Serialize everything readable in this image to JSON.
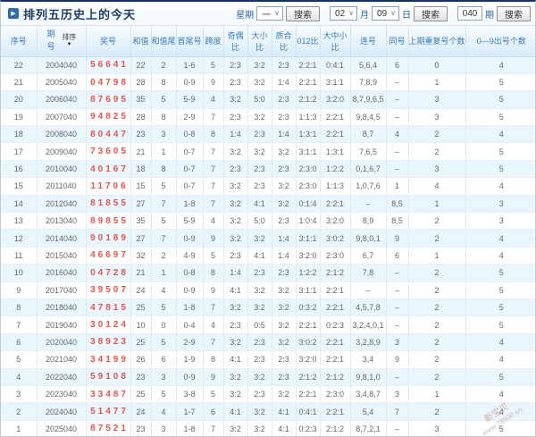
{
  "header": {
    "title": "排列五历史上的今天"
  },
  "controls": {
    "week_label": "星期",
    "week_value": "一",
    "month_value": "02",
    "month_label": "月",
    "day_value": "09",
    "day_label": "日",
    "issue_value": "040",
    "issue_label": "期",
    "search_label": "搜索"
  },
  "table": {
    "sort_label": "排序",
    "columns": [
      "序号",
      "期号",
      "奖号",
      "和值",
      "和值尾",
      "首尾号",
      "跨度",
      "奇偶比",
      "大小比",
      "质合比",
      "012比",
      "大中小比",
      "连号",
      "同号",
      "上期重复号个数",
      "0—9出号个数"
    ],
    "rows": [
      [
        "22",
        "2004040",
        "56641",
        "22",
        "2",
        "1-6",
        "5",
        "2:3",
        "3:2",
        "2:3",
        "2:2:1",
        "0:4:1",
        "5,6,4",
        "6",
        "0",
        "4"
      ],
      [
        "21",
        "2005040",
        "04798",
        "28",
        "8",
        "0-9",
        "9",
        "2:3",
        "3:2",
        "1:4",
        "2:2:1",
        "3:1:1",
        "7,8,9",
        "–",
        "1",
        "5"
      ],
      [
        "20",
        "2006040",
        "87695",
        "35",
        "5",
        "5-9",
        "4",
        "3:2",
        "5:0",
        "2:3",
        "2:1:2",
        "3:2:0",
        "8,7,9,6,5",
        "–",
        "3",
        "5"
      ],
      [
        "19",
        "2007040",
        "94825",
        "28",
        "8",
        "2-9",
        "7",
        "2:3",
        "3:2",
        "2:3",
        "1:1:3",
        "2:2:1",
        "9,8,4,5",
        "–",
        "3",
        "5"
      ],
      [
        "18",
        "2008040",
        "80447",
        "23",
        "3",
        "0-8",
        "8",
        "1:4",
        "2:3",
        "1:4",
        "1:3:1",
        "2:2:1",
        "8,7",
        "4",
        "2",
        "4"
      ],
      [
        "17",
        "2009040",
        "73605",
        "21",
        "1",
        "0-7",
        "7",
        "3:2",
        "3:2",
        "3:2",
        "3:1:1",
        "1:3:1",
        "7,6,5",
        "–",
        "2",
        "5"
      ],
      [
        "16",
        "2010040",
        "40167",
        "18",
        "8",
        "0-7",
        "7",
        "2:3",
        "2:3",
        "2:3",
        "2:3:0",
        "1:2:2",
        "0,1,6,7",
        "–",
        "3",
        "5"
      ],
      [
        "15",
        "2011040",
        "11706",
        "15",
        "5",
        "0-7",
        "7",
        "3:2",
        "2:3",
        "3:2",
        "2:3:0",
        "1:1:3",
        "1,0,7,6",
        "1",
        "4",
        "4"
      ],
      [
        "14",
        "2012040",
        "81855",
        "27",
        "7",
        "1-8",
        "7",
        "3:2",
        "4:1",
        "3:2",
        "0:1:4",
        "2:2:1",
        "–",
        "8,5",
        "1",
        "3"
      ],
      [
        "13",
        "2013040",
        "89855",
        "35",
        "5",
        "5-9",
        "4",
        "3:2",
        "5:0",
        "2:3",
        "1:0:4",
        "3:2:0",
        "8,9",
        "8,5",
        "2",
        "3"
      ],
      [
        "12",
        "2014040",
        "90189",
        "27",
        "7",
        "0-9",
        "9",
        "3:2",
        "3:2",
        "1:4",
        "3:1:1",
        "3:0:2",
        "9,8,0,1",
        "9",
        "2",
        "4"
      ],
      [
        "11",
        "2015040",
        "46697",
        "32",
        "2",
        "4-9",
        "5",
        "2:3",
        "4:1",
        "1:4",
        "3:2:0",
        "2:3:0",
        "6,7",
        "6",
        "1",
        "4"
      ],
      [
        "10",
        "2016040",
        "04728",
        "21",
        "1",
        "0-8",
        "8",
        "1:4",
        "2:3",
        "2:3",
        "1:2:2",
        "2:1:2",
        "7,8",
        "–",
        "2",
        "5"
      ],
      [
        "9",
        "2017040",
        "39507",
        "24",
        "4",
        "0-9",
        "9",
        "4:1",
        "3:2",
        "3:2",
        "3:1:1",
        "2:2:1",
        "–",
        "–",
        "2",
        "5"
      ],
      [
        "8",
        "2018040",
        "47815",
        "25",
        "5",
        "1-8",
        "7",
        "3:2",
        "3:2",
        "3:2",
        "0:3:2",
        "2:2:1",
        "4,5,7,8",
        "–",
        "2",
        "5"
      ],
      [
        "7",
        "2019040",
        "30124",
        "10",
        "0",
        "0-4",
        "4",
        "2:3",
        "0:5",
        "3:2",
        "2:2:1",
        "0:2:3",
        "3,2,4,0,1",
        "–",
        "2",
        "5"
      ],
      [
        "6",
        "2020040",
        "38923",
        "25",
        "5",
        "2-9",
        "7",
        "3:2",
        "2:3",
        "3:2",
        "3:0:2",
        "2:2:1",
        "3,2,8,9",
        "3",
        "2",
        "4"
      ],
      [
        "5",
        "2021040",
        "34199",
        "26",
        "6",
        "1-9",
        "8",
        "4:1",
        "2:3",
        "2:3",
        "3:2:0",
        "2:2:1",
        "3,4",
        "9",
        "2",
        "4"
      ],
      [
        "4",
        "2022040",
        "59108",
        "23",
        "3",
        "0-9",
        "9",
        "3:2",
        "3:2",
        "2:3",
        "2:1:2",
        "2:1:2",
        "9,8,1,0",
        "–",
        "2",
        "5"
      ],
      [
        "3",
        "2023040",
        "33487",
        "25",
        "5",
        "3-8",
        "5",
        "3:2",
        "2:3",
        "3:2",
        "2:2:1",
        "2:3:0",
        "3,4,8,7",
        "3",
        "1",
        "4"
      ],
      [
        "2",
        "2024040",
        "51477",
        "24",
        "4",
        "1-7",
        "6",
        "4:1",
        "3:2",
        "4:1",
        "0:4:1",
        "2:2:1",
        "5,4",
        "7",
        "2",
        "4"
      ],
      [
        "1",
        "2025040",
        "87521",
        "23",
        "3",
        "1-8",
        "7",
        "3:2",
        "3:2",
        "4:1",
        "0:2:3",
        "2:1:2",
        "8,7,2,1",
        "–",
        "3",
        "5"
      ]
    ]
  },
  "watermark": {
    "line1": "新宝贝",
    "line2": "www.78500.cn"
  },
  "colors": {
    "accent_blue": "#2f6bb0",
    "header_text_blue": "#3c7cb4",
    "lottery_red": "#e2554d",
    "row_alt_blue": "#e9f6fe",
    "top_border_navy": "#17345f"
  }
}
